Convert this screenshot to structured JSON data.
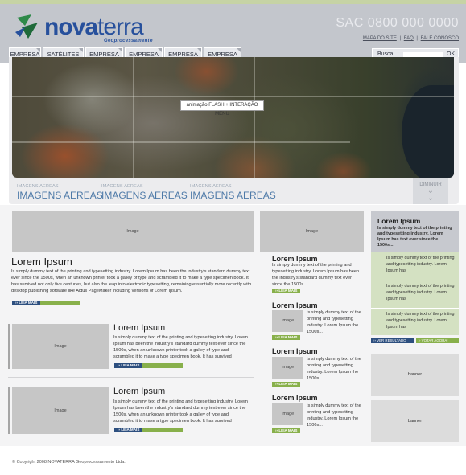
{
  "brand": {
    "name_part1": "nova",
    "name_part2": "terra",
    "tagline": "Geoprocessamento",
    "accent": "#27509c",
    "leaf_color": "#1f6a3a"
  },
  "header": {
    "sac": "SAC 0800 000 0000",
    "links": [
      "MAPA DO SITE",
      "FAQ",
      "FALE CONOSCO"
    ],
    "separator": "|"
  },
  "tabs": [
    "EMPRESA",
    "SATÉLITES",
    "EMPRESA",
    "EMPRESA",
    "EMPRESA",
    "EMPRESA"
  ],
  "search": {
    "label": "Busca",
    "value": "",
    "button": "OK"
  },
  "hero": {
    "flash_label": "animação FLASH + INTERAÇÃO MENU"
  },
  "image_nav": [
    {
      "small": "IMAGENS AEREAS",
      "big": "IMAGENS AEREAS"
    },
    {
      "small": "IMAGENS AEREAS",
      "big": "IMAGENS AEREAS"
    },
    {
      "small": "IMAGENS AEREAS",
      "big": "IMAGENS AEREAS"
    }
  ],
  "diminuir": {
    "label": "DIMINUIR",
    "icon": "chevron-down-icon"
  },
  "main": {
    "feature": {
      "image": "Image",
      "title": "Lorem Ipsum",
      "text": "Is simply dummy text of the printing and typesetting industry. Lorem Ipsum has been the industry's standard dummy text ever since the 1500s, when an unknown printer took a galley of type and scrambled it to make a type specimen book. It has survived not only five centuries, but also the leap into electronic typesetting, remaining essentially more recently with desktop publishing software like Aldus PageMaker including versions of Lorem Ipsum.",
      "button": "LEIA MAIS"
    },
    "articles": [
      {
        "image": "Image",
        "title": "Lorem Ipsum",
        "text": "Is simply dummy text of the printing and typesetting industry. Lorem Ipsum has been the industry's standard dummy text ever since the 1500s, when an unknown printer took a galley of type and scrambled it to make a type specimen book. It has survived",
        "button": "LEIA MAIS"
      },
      {
        "image": "Image",
        "title": "Lorem Ipsum",
        "text": "Is simply dummy text of the printing and typesetting industry. Lorem Ipsum has been the industry's standard dummy text ever since the 1500s, when an unknown printer took a galley of type and scrambled it to make a type specimen book. It has survived",
        "button": "LEIA MAIS"
      }
    ]
  },
  "middle": {
    "top": {
      "image": "Image",
      "title": "Lorem Ipsum",
      "text": "Is simply dummy text of the printing and typesetting industry. Lorem Ipsum has been the industry's standard dummy text ever since the 1500s...",
      "button": "LEIA MAIS"
    },
    "items": [
      {
        "image": "Image",
        "title": "Lorem Ipsum",
        "text": "Is simply dummy text of the printing and typesetting industry. Lorem Ipsum the 1500s...",
        "button": "LEIA MAIS"
      },
      {
        "image": "Image",
        "title": "Lorem Ipsum",
        "text": "Is simply dummy text of the printing and typesetting industry. Lorem Ipsum the 1500s...",
        "button": "LEIA MAIS"
      },
      {
        "image": "Image",
        "title": "Lorem Ipsum",
        "text": "Is simply dummy text of the printing and typesetting industry. Lorem Ipsum the 1500s...",
        "button": "LEIA MAIS"
      }
    ]
  },
  "sidebar": {
    "poll": {
      "title": "Lorem Ipsum",
      "text": "Is simply dummy text of the printing and typesetting industry. Lorem Ipsum has text ever since the 1500s..."
    },
    "options": [
      "Is simply dummy text of the printing and typesetting industry. Lorem Ipsum has",
      "Is simply dummy text of the printing and typesetting industry. Lorem Ipsum has",
      "Is simply dummy text of the printing and typesetting industry. Lorem Ipsum has"
    ],
    "btn_results": "VER RESULTADO",
    "btn_vote": "VOTAR AGORA!",
    "banners": [
      "banner",
      "banner"
    ]
  },
  "footer": "© Copyright 2008 NOVATERRA Geoprocessamento Ltda."
}
